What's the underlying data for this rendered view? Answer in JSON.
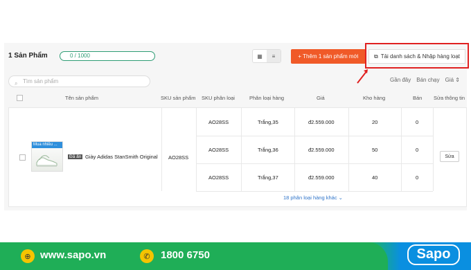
{
  "header": {
    "count_title": "1 Sản Phẩm",
    "progress_text": "0 / 1000",
    "add_button": "+ Thêm 1 sản phẩm mới",
    "import_button": "Tải danh sách & Nhập hàng loạt"
  },
  "search": {
    "placeholder": "Tìm sản phẩm"
  },
  "sort": {
    "latest": "Gần đây",
    "best_selling": "Bán chạy",
    "price": "Giá ⇕"
  },
  "table": {
    "headers": [
      "Tên sản phẩm",
      "SKU sản phẩm",
      "SKU phân loại",
      "Phân loại hàng",
      "Giá",
      "Kho hàng",
      "Bán",
      "Sửa thông tin"
    ],
    "product": {
      "badge": "Mua nhiều ...",
      "tag": "Đã ẩn",
      "name": "Giày Adidas StanSmith Original",
      "sku": "AO28SS",
      "variants": [
        {
          "sku": "AO28SS",
          "variant": "Trắng,35",
          "price": "đ2.559.000",
          "stock": "20",
          "sold": "0"
        },
        {
          "sku": "AO28SS",
          "variant": "Trắng,36",
          "price": "đ2.559.000",
          "stock": "50",
          "sold": "0"
        },
        {
          "sku": "AO28SS",
          "variant": "Trắng,37",
          "price": "đ2.559.000",
          "stock": "40",
          "sold": "0"
        }
      ],
      "edit_button": "Sửa",
      "more_link": "18 phân loại hàng khác ⌄"
    }
  },
  "footer": {
    "website": "www.sapo.vn",
    "phone": "1800 6750",
    "logo": "Sapo"
  }
}
